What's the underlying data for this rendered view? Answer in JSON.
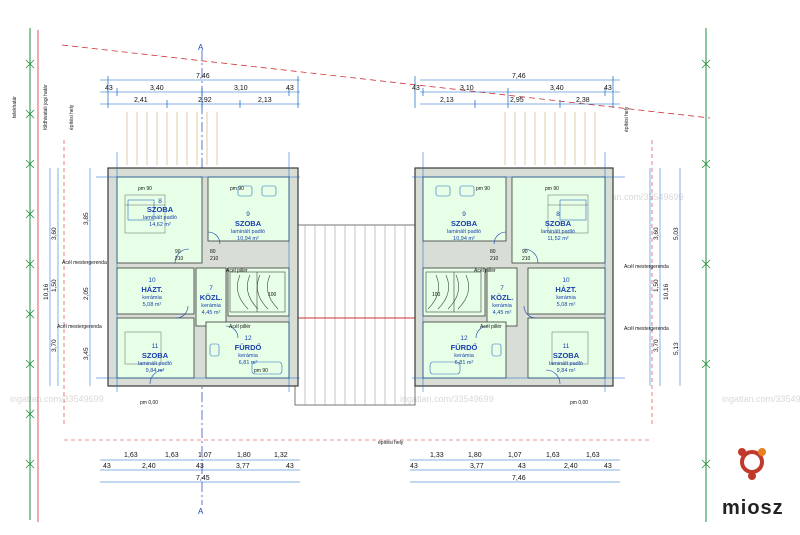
{
  "plan": {
    "watermark": "ingatlan.com/33549699",
    "logo_text": "miosz",
    "section_mark": "A",
    "notes": {
      "boundary_1": "telekhatár",
      "boundary_2": "földhivatali jogi határ",
      "building_line_left": "építési hely",
      "building_line_right": "építési hely",
      "building_line_bottom": "építési hely",
      "lintel": "Acél mestergerenda",
      "pillar": "Acél pillér"
    },
    "top_dims": {
      "left_total": "7,46",
      "left_row1": [
        "43",
        "3,40",
        "3,10",
        "43"
      ],
      "left_row2": [
        "2,41",
        "2,92",
        "2,13"
      ],
      "right_total": "7,46",
      "right_row1": [
        "43",
        "3,10",
        "3,40",
        "43"
      ],
      "right_row2": [
        "2,13",
        "2,95",
        "2,38"
      ]
    },
    "bottom_dims": {
      "left_row1": [
        "1,63",
        "1,63",
        "1,07",
        "1,80",
        "1,32"
      ],
      "left_row2": [
        "43",
        "2,40",
        "43",
        "3,77",
        "43"
      ],
      "left_total": "7,45",
      "right_row1": [
        "1,33",
        "1,80",
        "1,07",
        "1,63",
        "1,63"
      ],
      "right_row2": [
        "43",
        "3,77",
        "43",
        "2,40",
        "43"
      ],
      "right_total": "7,46"
    },
    "side_dims": {
      "left_outer": [
        "43",
        "3,60",
        "1,50",
        "3,70",
        "43"
      ],
      "left_total": "10,16",
      "left_inner": [
        "3,85",
        "2,05",
        "3,45"
      ],
      "right_outer": [
        "43",
        "3,60",
        "1,50",
        "3,70",
        "43"
      ],
      "right_total": "10,16",
      "right_inner": [
        "5,03",
        "5,13"
      ]
    },
    "rooms_left": [
      {
        "num": "8",
        "name": "SZOBA",
        "floor": "laminált padló",
        "area": "14,62 m²"
      },
      {
        "num": "9",
        "name": "SZOBA",
        "floor": "laminált padló",
        "area": "10,94 m²"
      },
      {
        "num": "10",
        "name": "HÁZT.",
        "floor": "kerámia",
        "area": "5,08 m²"
      },
      {
        "num": "7",
        "name": "KÖZL.",
        "floor": "kerámia",
        "area": "4,45 m²"
      },
      {
        "num": "11",
        "name": "SZOBA",
        "floor": "laminált padló",
        "area": "9,84 m²"
      },
      {
        "num": "12",
        "name": "FÜRDŐ",
        "floor": "kerámia",
        "area": "6,81 m²"
      }
    ],
    "rooms_right": [
      {
        "num": "9",
        "name": "SZOBA",
        "floor": "laminált padló",
        "area": "10,94 m²"
      },
      {
        "num": "8",
        "name": "SZOBA",
        "floor": "laminált padló",
        "area": "11,52 m²"
      },
      {
        "num": "7",
        "name": "KÖZL.",
        "floor": "kerámia",
        "area": "4,45 m²"
      },
      {
        "num": "10",
        "name": "HÁZT.",
        "floor": "kerámia",
        "area": "5,08 m²"
      },
      {
        "num": "12",
        "name": "FÜRDŐ",
        "floor": "kerámia",
        "area": "6,81 m²"
      },
      {
        "num": "11",
        "name": "SZOBA",
        "floor": "laminált padló",
        "area": "9,84 m²"
      }
    ],
    "levels": [
      "pm 90",
      "pm 0,00",
      "pm 90",
      "pm 0,00"
    ],
    "door_widths": [
      "90",
      "210",
      "80",
      "210",
      "100"
    ],
    "colors": {
      "wall": "#3a3a3a",
      "wall_fill": "#d8ddd6",
      "room_fill": "#e6ffe6",
      "dim_line": "#0a64c8",
      "axis_line": "#1a3fae",
      "boundary_red": "#d03030",
      "boundary_green": "#1e8c3c"
    }
  }
}
